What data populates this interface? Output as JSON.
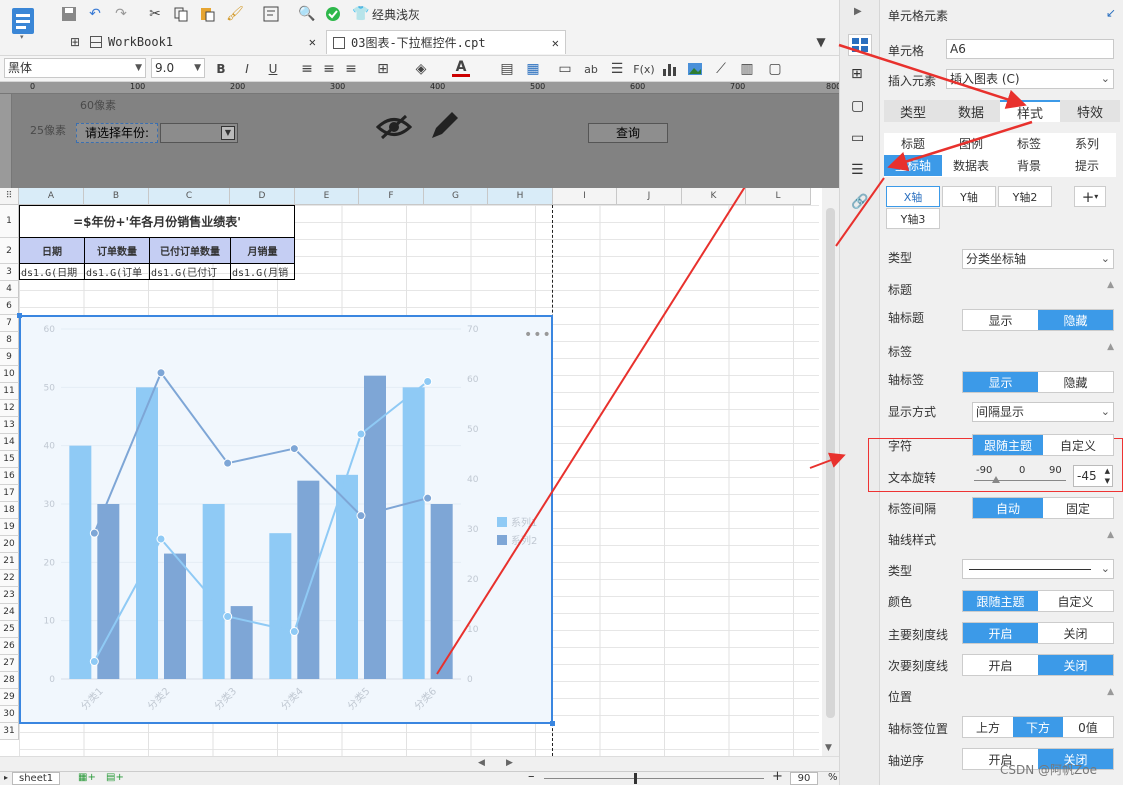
{
  "toolbar": {
    "theme_label": "经典浅灰"
  },
  "tabs": [
    {
      "label": "WorkBook1"
    },
    {
      "label": "03图表-下拉框控件.cpt"
    }
  ],
  "format": {
    "font": "黑体",
    "size": "9.0",
    "bold": "B",
    "italic": "I",
    "underline": "U",
    "fx": "F(x)",
    "ab": "ab"
  },
  "ruler": {
    "ticks": [
      "0",
      "100",
      "200",
      "300",
      "400",
      "500",
      "600",
      "700",
      "800"
    ]
  },
  "param": {
    "px60": "60像素",
    "px25": "25像素",
    "label": "请选择年份:",
    "query": "查询"
  },
  "sheet": {
    "cols": [
      "A",
      "B",
      "C",
      "D",
      "E",
      "F",
      "G",
      "H",
      "I",
      "J",
      "K",
      "L"
    ],
    "rows": [
      "1",
      "2",
      "3",
      "4",
      "6",
      "7",
      "8",
      "9",
      "10",
      "11",
      "12",
      "13",
      "14",
      "15",
      "16",
      "17",
      "18",
      "19",
      "20",
      "21",
      "22",
      "23",
      "24",
      "25",
      "26",
      "27",
      "28",
      "29",
      "30",
      "31"
    ],
    "title": "=$年份+'年各月份销售业绩表'",
    "headers": [
      "日期",
      "订单数量",
      "已付订单数量",
      "月销量"
    ],
    "formulas": [
      "ds1.G(日期",
      "ds1.G(订单",
      "ds1.G(已付订",
      "ds1.G(月销"
    ]
  },
  "chart_data": {
    "type": "bar",
    "categories": [
      "分类1",
      "分类2",
      "分类3",
      "分类4",
      "分类5",
      "分类6"
    ],
    "series": [
      {
        "name": "系列1",
        "kind": "bar",
        "axis": "left",
        "values": [
          40,
          50,
          30,
          25,
          35,
          50
        ]
      },
      {
        "name": "系列2",
        "kind": "bar",
        "axis": "left",
        "values": [
          30,
          21.5,
          12.5,
          34,
          52,
          30
        ]
      },
      {
        "kind": "line",
        "axis": "right",
        "values": [
          3.5,
          28,
          12.5,
          9.5,
          49,
          59.5
        ]
      },
      {
        "kind": "line",
        "axis": "left",
        "values": [
          25,
          52.5,
          37,
          39.5,
          28,
          31
        ]
      }
    ],
    "y_left": {
      "ticks": [
        "0",
        "10",
        "20",
        "30",
        "40",
        "50",
        "60"
      ],
      "max": 60
    },
    "y_right": {
      "ticks": [
        "0",
        "10",
        "20",
        "30",
        "40",
        "50",
        "60",
        "70"
      ],
      "max": 70
    },
    "colors": {
      "s1": "#8fcaf5",
      "s2": "#7ea6d6",
      "l1": "#8fcaf5",
      "l2": "#7ea6d6"
    },
    "legend": "right"
  },
  "panel": {
    "title": "单元格元素",
    "cell_label": "单元格",
    "cell_value": "A6",
    "insert_label": "插入元素",
    "insert_value": "插入图表 (C)",
    "main_tabs": [
      "类型",
      "数据",
      "样式",
      "特效"
    ],
    "sub_tabs": [
      "标题",
      "图例",
      "标签",
      "系列",
      "坐标轴",
      "数据表",
      "背景",
      "提示"
    ],
    "axis_tabs": [
      "X轴",
      "Y轴",
      "Y轴2",
      "Y轴3"
    ],
    "type_label": "类型",
    "type_value": "分类坐标轴",
    "sec_title": "标题",
    "axis_title_label": "轴标题",
    "show": "显示",
    "hide": "隐藏",
    "sec_label": "标签",
    "axis_label_label": "轴标签",
    "display_mode_label": "显示方式",
    "display_mode_value": "间隔显示",
    "char_label": "字符",
    "follow_theme": "跟随主题",
    "custom": "自定义",
    "rotate_label": "文本旋转",
    "rotate_min": "-90",
    "rotate_zero": "0",
    "rotate_max": "90",
    "rotate_value": "-45",
    "interval_label": "标签间隔",
    "auto": "自动",
    "fixed": "固定",
    "sec_axis_style": "轴线样式",
    "line_type_label": "类型",
    "color_label": "颜色",
    "major_tick_label": "主要刻度线",
    "on": "开启",
    "off": "关闭",
    "minor_tick_label": "次要刻度线",
    "sec_position": "位置",
    "label_pos_label": "轴标签位置",
    "pos_top": "上方",
    "pos_bottom": "下方",
    "pos_zero": "0值",
    "reverse_label": "轴逆序"
  },
  "status": {
    "sheet": "sheet1",
    "zoom": "90",
    "pct": "%"
  },
  "watermark": "CSDN @阿帆Zoe"
}
